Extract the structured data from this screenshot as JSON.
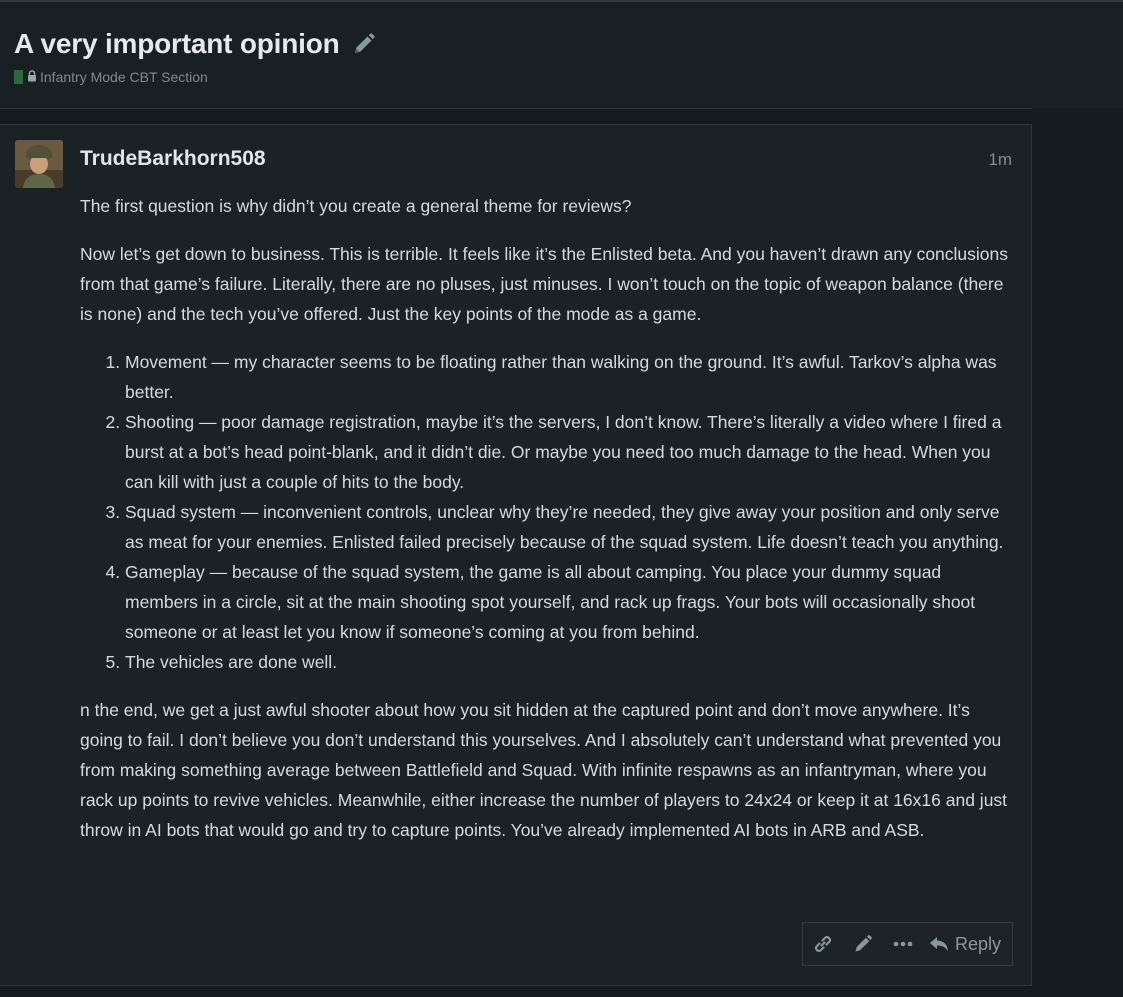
{
  "topic": {
    "title": "A very important opinion",
    "category": "Infantry Mode CBT Section"
  },
  "post": {
    "username": "TrudeBarkhorn508",
    "time": "1m",
    "paragraphs": [
      "The first question is why didn’t you create a general theme for reviews?",
      "Now let’s get down to business. This is terrible. It feels like it’s the Enlisted beta. And you haven’t drawn any conclusions from that game’s failure. Literally, there are no pluses, just minuses. I won’t touch on the topic of weapon balance (there is none) and the tech you’ve offered. Just the key points of the mode as a game."
    ],
    "list": [
      "Movement — my character seems to be floating rather than walking on the ground. It’s awful. Tarkov’s alpha was better.",
      "Shooting — poor damage registration, maybe it’s the servers, I don’t know. There’s literally a video where I fired a burst at a bot’s head point-blank, and it didn’t die. Or maybe you need too much damage to the head. When you can kill with just a couple of hits to the body.",
      "Squad system — inconvenient controls, unclear why they’re needed, they give away your position and only serve as meat for your enemies. Enlisted failed precisely because of the squad system. Life doesn’t teach you anything.",
      "Gameplay — because of the squad system, the game is all about camping. You place your dummy squad members in a circle, sit at the main shooting spot yourself, and rack up frags. Your bots will occasionally shoot someone or at least let you know if someone’s coming at you from behind.",
      "The vehicles are done well."
    ],
    "closing": "n the end, we get a just awful shooter about how you sit hidden at the captured point and don’t move anywhere. It’s going to fail. I don’t believe you don’t understand this yourselves. And I absolutely can’t understand what prevented you from making something average between Battlefield and Squad. With infinite respawns as an infantryman, where you rack up points to revive vehicles. Meanwhile, either increase the number of players to 24x24 or keep it at 16x16 and just throw in AI bots that would go and try to capture points. You’ve already implemented AI bots in ARB and ASB."
  },
  "actions": {
    "reply_label": "Reply"
  },
  "icons": {
    "title_edit": "pencil-icon",
    "lock": "lock-icon",
    "link": "link-icon",
    "edit": "pencil-icon",
    "more": "ellipsis-icon",
    "reply": "reply-icon"
  },
  "colors": {
    "background": "#141a1e",
    "post_background": "#1a2226",
    "category": "#2b6b3a",
    "muted_text": "#7e8a90"
  }
}
